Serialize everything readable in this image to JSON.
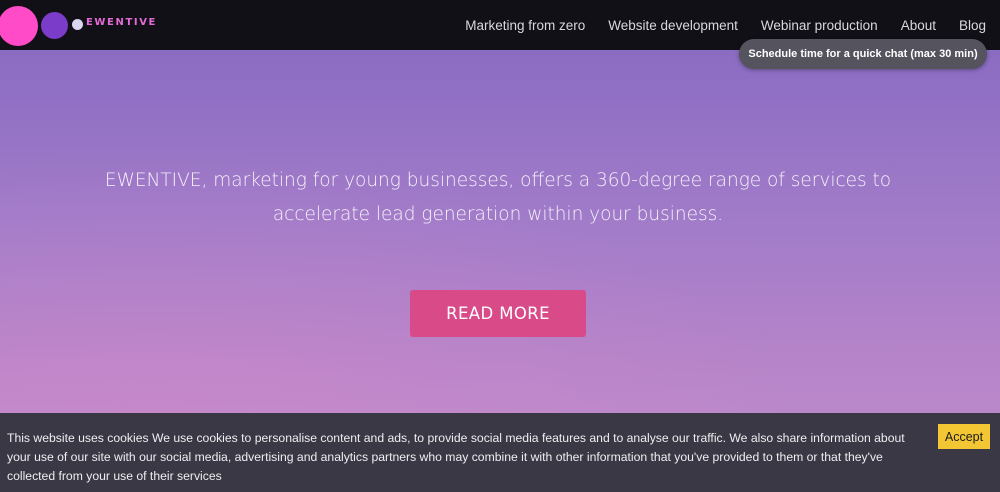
{
  "header": {
    "brand": "EWENTIVE",
    "nav": [
      {
        "label": "Marketing from zero"
      },
      {
        "label": "Website development"
      },
      {
        "label": "Webinar production"
      },
      {
        "label": "About"
      },
      {
        "label": "Blog"
      }
    ]
  },
  "hero": {
    "text": "EWENTIVE, marketing for young businesses, offers a 360-degree range of services to accelerate lead generation within your business.",
    "cta_label": "READ MORE"
  },
  "cookie_banner": {
    "text": "This website uses cookies We use cookies to personalise content and ads, to provide social media features and to analyse our traffic. We also share information about your use of our site with our social media, advertising and analytics partners who may combine it with other information that you've provided to them or that they've collected from your use of their services",
    "accept_label": "Accept"
  },
  "chat_widget": {
    "label": "Schedule time for a quick chat (max 30 min)"
  },
  "colors": {
    "nav_bg": "#111016",
    "brand_pink": "#ff4bc8",
    "brand_purple": "#7a3cc9",
    "cta_bg": "#d94a89",
    "accept_bg": "#f3c734",
    "banner_bg": "#3a3844"
  }
}
